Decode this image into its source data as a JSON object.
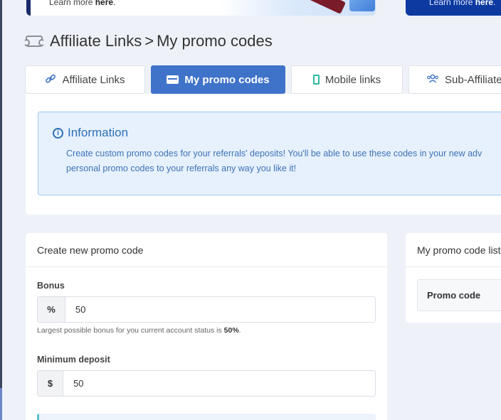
{
  "banners": {
    "left_text": "Learn more ",
    "left_link": "here",
    "left_suffix": ".",
    "right_text": "Learn more ",
    "right_link": "here",
    "right_suffix": "."
  },
  "breadcrumb": {
    "section": "Affiliate Links",
    "separator": ">",
    "current": "My promo codes"
  },
  "tabs": [
    {
      "label": "Affiliate Links",
      "icon": "link-icon",
      "active": false
    },
    {
      "label": "My promo codes",
      "icon": "card-icon",
      "active": true
    },
    {
      "label": "Mobile links",
      "icon": "mobile-icon",
      "active": false
    },
    {
      "label": "Sub-Affiliate",
      "icon": "users-icon",
      "active": false
    }
  ],
  "info": {
    "title": "Information",
    "line1": "Create custom promo codes for your referrals' deposits! You'll be able to use these codes in your new adv",
    "line2": "personal promo codes to your referrals any way you like it!"
  },
  "create": {
    "title": "Create new promo code",
    "bonus_label": "Bonus",
    "bonus_addon": "%",
    "bonus_value": "50",
    "hint_prefix": "Largest possible bonus for you current account status is ",
    "hint_value": "50%",
    "hint_suffix": ".",
    "min_deposit_label": "Minimum deposit",
    "min_deposit_addon": "$",
    "min_deposit_value": "50"
  },
  "list": {
    "title": "My promo code list",
    "column_promo_code": "Promo code"
  },
  "colors": {
    "accent": "#3f73c9",
    "info_text": "#3e72b6",
    "page_bg": "#eef2f8"
  }
}
